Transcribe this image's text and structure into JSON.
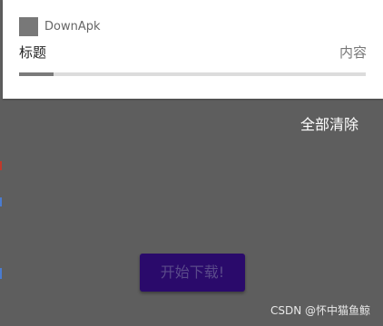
{
  "notification": {
    "app_name": "DownApk",
    "title": "标题",
    "content": "内容",
    "progress": 0.1
  },
  "shade": {
    "clear_all": "全部清除"
  },
  "app": {
    "start_button": "开始下载!"
  },
  "watermark": "CSDN @怀中猫鱼鲸",
  "colors": {
    "button_bg": "#2a0a6b",
    "scrim": "#5e5e5e"
  }
}
